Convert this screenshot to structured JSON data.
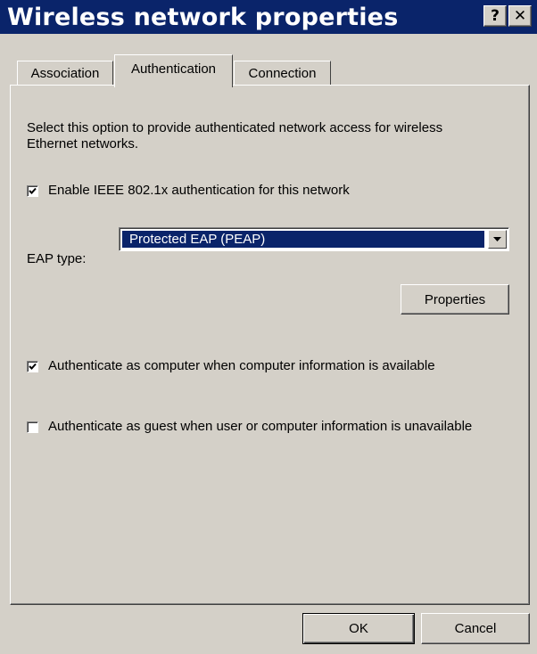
{
  "window": {
    "title": "Wireless network properties",
    "help_glyph": "?",
    "close_glyph": "✕"
  },
  "tabs": [
    {
      "label": "Association",
      "selected": false
    },
    {
      "label": "Authentication",
      "selected": true
    },
    {
      "label": "Connection",
      "selected": false
    }
  ],
  "auth": {
    "description": "Select this option to provide authenticated network access for wireless Ethernet networks.",
    "enable_8021x": {
      "label": "Enable IEEE 802.1x authentication for this network",
      "checked": true
    },
    "eap_label": "EAP type:",
    "eap_value": "Protected EAP (PEAP)",
    "properties_label": "Properties",
    "auth_computer": {
      "label": "Authenticate as computer when computer information is available",
      "checked": true
    },
    "auth_guest": {
      "label": "Authenticate as guest when user or computer information is unavailable",
      "checked": false
    }
  },
  "footer": {
    "ok_label": "OK",
    "cancel_label": "Cancel"
  },
  "colors": {
    "titlebar": "#0a246a",
    "face": "#d4d0c8",
    "selection": "#0a246a"
  }
}
